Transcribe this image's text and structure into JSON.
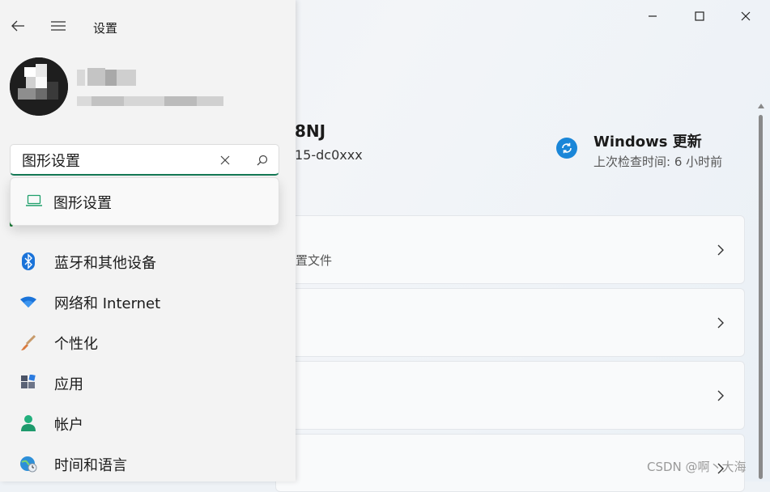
{
  "window": {
    "title": "设置",
    "minimize_icon": "minimize-icon",
    "maximize_icon": "maximize-icon",
    "close_icon": "close-icon"
  },
  "search": {
    "value": "图形设置",
    "suggestion": "图形设置"
  },
  "sidebar": {
    "items": [
      {
        "label": "蓝牙和其他设备",
        "icon": "bluetooth-icon"
      },
      {
        "label": "网络和 Internet",
        "icon": "wifi-icon"
      },
      {
        "label": "个性化",
        "icon": "brush-icon"
      },
      {
        "label": "应用",
        "icon": "apps-icon"
      },
      {
        "label": "帐户",
        "icon": "account-icon"
      },
      {
        "label": "时间和语言",
        "icon": "globe-clock-icon"
      }
    ]
  },
  "device": {
    "name_partial": "8NJ",
    "model_partial": "15-dc0xxx"
  },
  "windows_update": {
    "title": "Windows 更新",
    "subtitle": "上次检查时间: 6 小时前"
  },
  "cards": [
    {
      "subtitle_partial": "置文件"
    },
    {
      "subtitle_partial": ""
    },
    {
      "subtitle_partial": ""
    },
    {
      "subtitle_partial": ""
    }
  ],
  "watermark": "CSDN @啊丶大海",
  "colors": {
    "accent": "#157a56",
    "update_blue": "#1a86d8"
  }
}
